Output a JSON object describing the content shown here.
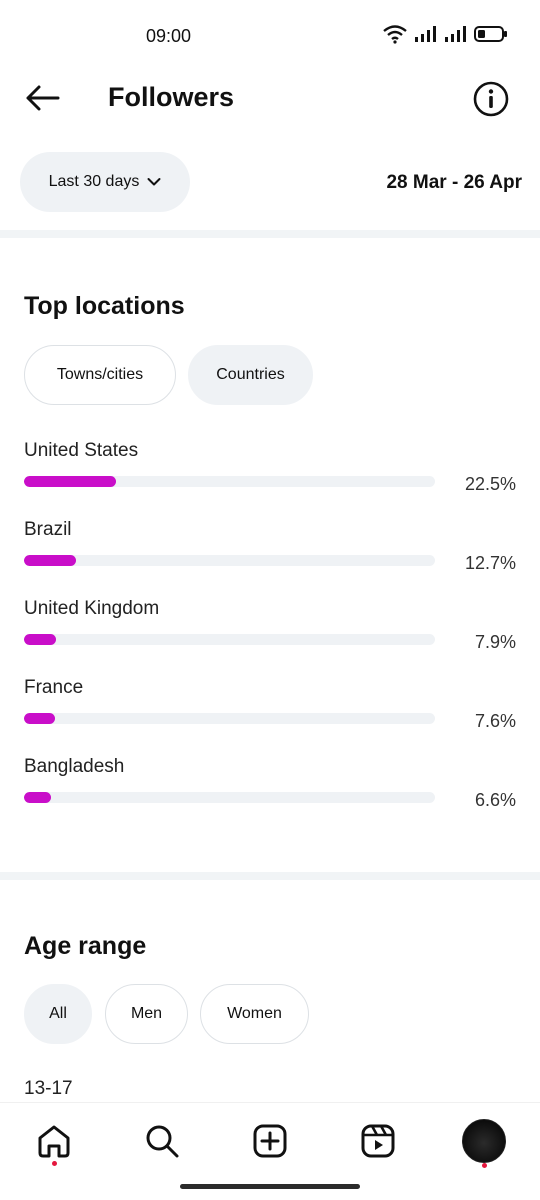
{
  "status_bar": {
    "time": "09:00"
  },
  "header": {
    "title": "Followers"
  },
  "range": {
    "selector_label": "Last 30 days",
    "dates": "28 Mar - 26 Apr"
  },
  "top_locations": {
    "title": "Top locations",
    "tabs": [
      {
        "label": "Towns/cities",
        "selected": false
      },
      {
        "label": "Countries",
        "selected": true
      }
    ],
    "items": [
      {
        "name": "United States",
        "percent": 22.5,
        "label": "22.5%"
      },
      {
        "name": "Brazil",
        "percent": 12.7,
        "label": "12.7%"
      },
      {
        "name": "United Kingdom",
        "percent": 7.9,
        "label": "7.9%"
      },
      {
        "name": "France",
        "percent": 7.6,
        "label": "7.6%"
      },
      {
        "name": "Bangladesh",
        "percent": 6.6,
        "label": "6.6%"
      }
    ],
    "bar_color": "#c90ec9"
  },
  "age_range": {
    "title": "Age range",
    "tabs": [
      {
        "label": "All",
        "selected": true
      },
      {
        "label": "Men",
        "selected": false
      },
      {
        "label": "Women",
        "selected": false
      }
    ],
    "first_bucket": "13-17"
  },
  "bottom_nav": {
    "items": [
      "home-icon",
      "search-icon",
      "create-icon",
      "reels-icon",
      "profile-avatar"
    ]
  }
}
